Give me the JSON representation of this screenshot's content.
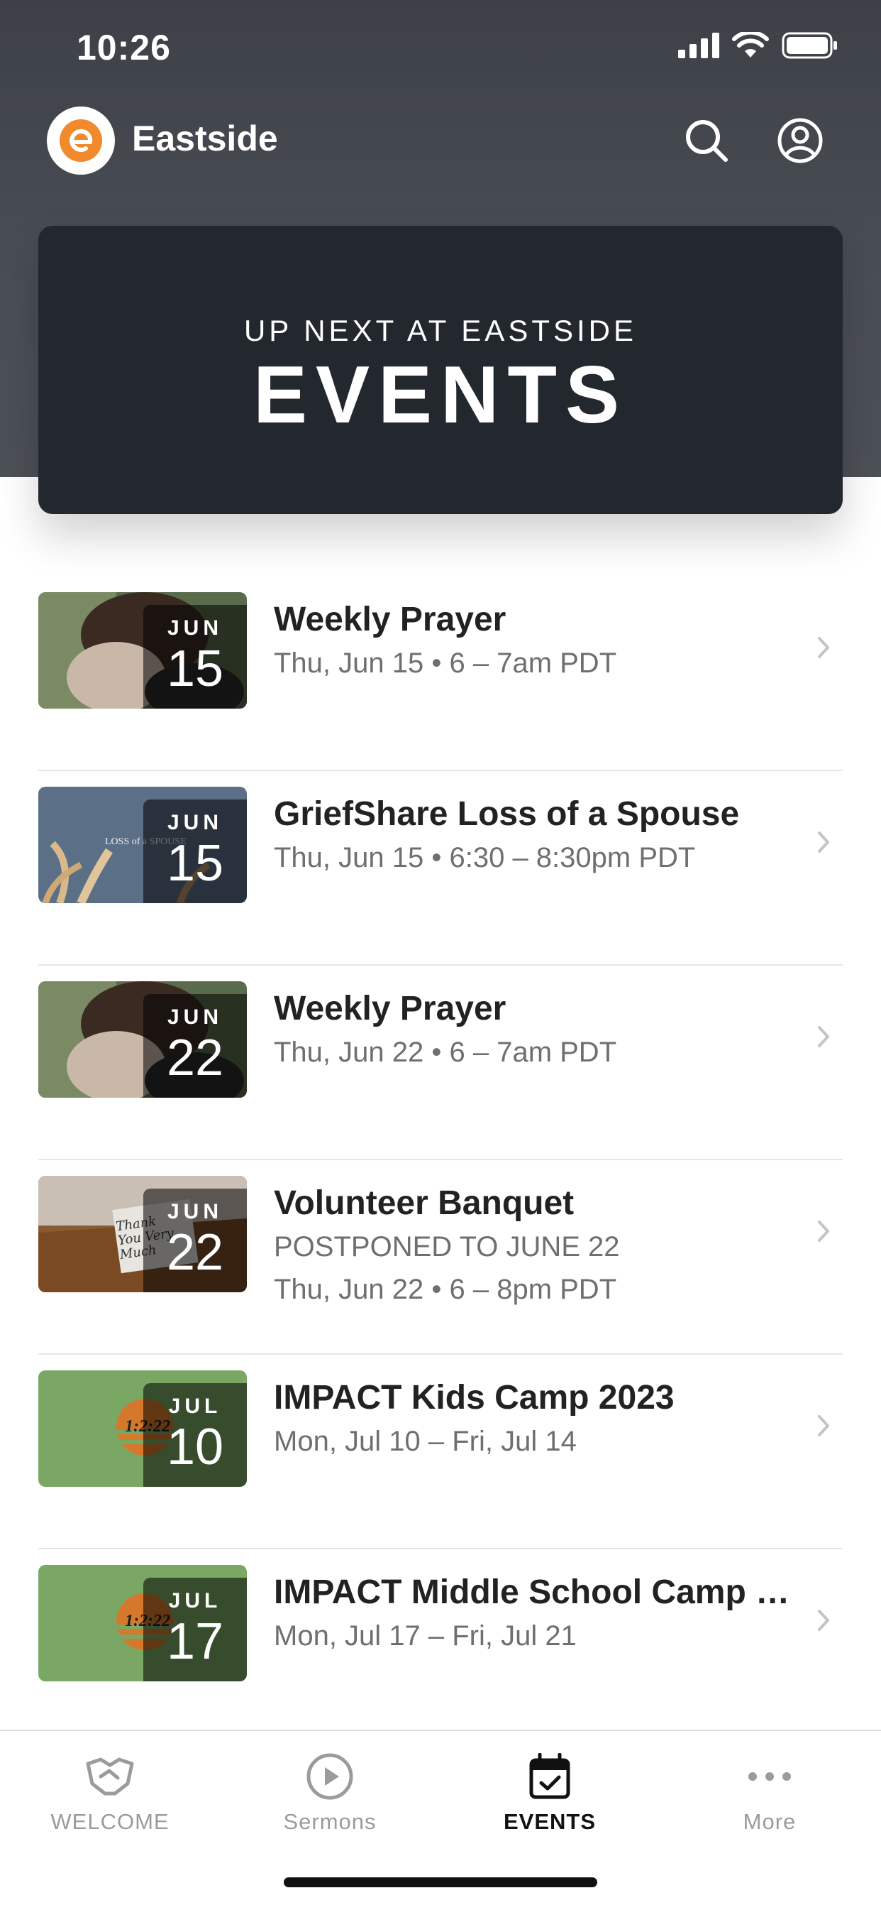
{
  "status_bar": {
    "time": "10:26"
  },
  "app_bar": {
    "brand": "Eastside"
  },
  "hero": {
    "subtitle": "UP NEXT AT EASTSIDE",
    "title": "EVENTS"
  },
  "events": [
    {
      "month": "JUN",
      "day": "15",
      "title": "Weekly Prayer",
      "lines": [
        "Thu, Jun 15 • 6 – 7am PDT"
      ],
      "thumb": "prayer"
    },
    {
      "month": "JUN",
      "day": "15",
      "title": "GriefShare Loss of a Spouse",
      "lines": [
        "Thu, Jun 15 • 6:30 – 8:30pm PDT"
      ],
      "thumb_text": "LOSS of a SPOUSE",
      "thumb": "pampas"
    },
    {
      "month": "JUN",
      "day": "22",
      "title": "Weekly Prayer",
      "lines": [
        "Thu, Jun 22 • 6 – 7am PDT"
      ],
      "thumb": "prayer"
    },
    {
      "month": "JUN",
      "day": "22",
      "title": "Volunteer Banquet",
      "lines": [
        "POSTPONED TO JUNE 22",
        "Thu, Jun 22 • 6 – 8pm PDT"
      ],
      "thumb_text": "Thank You Very Much",
      "thumb": "card"
    },
    {
      "month": "JUL",
      "day": "10",
      "title": "IMPACT Kids Camp 2023",
      "lines": [
        "Mon, Jul 10 – Fri, Jul 14"
      ],
      "thumb_text": "1:2:22",
      "thumb": "camp"
    },
    {
      "month": "JUL",
      "day": "17",
      "title": "IMPACT Middle School Camp 2...",
      "lines": [
        "Mon, Jul 17 – Fri, Jul 21"
      ],
      "thumb_text": "1:2:22",
      "thumb": "camp"
    }
  ],
  "tabs": [
    {
      "label": "WELCOME",
      "icon": "handshake-icon",
      "active": false
    },
    {
      "label": "Sermons",
      "icon": "play-circle-icon",
      "active": false
    },
    {
      "label": "EVENTS",
      "icon": "calendar-check-icon",
      "active": true
    },
    {
      "label": "More",
      "icon": "ellipsis-icon",
      "active": false
    }
  ],
  "colors": {
    "accent": "#f08a2c",
    "header": "#44484f",
    "hero": "#23282f",
    "active_tab": "#111111",
    "inactive_tab": "#9b9b9b"
  }
}
